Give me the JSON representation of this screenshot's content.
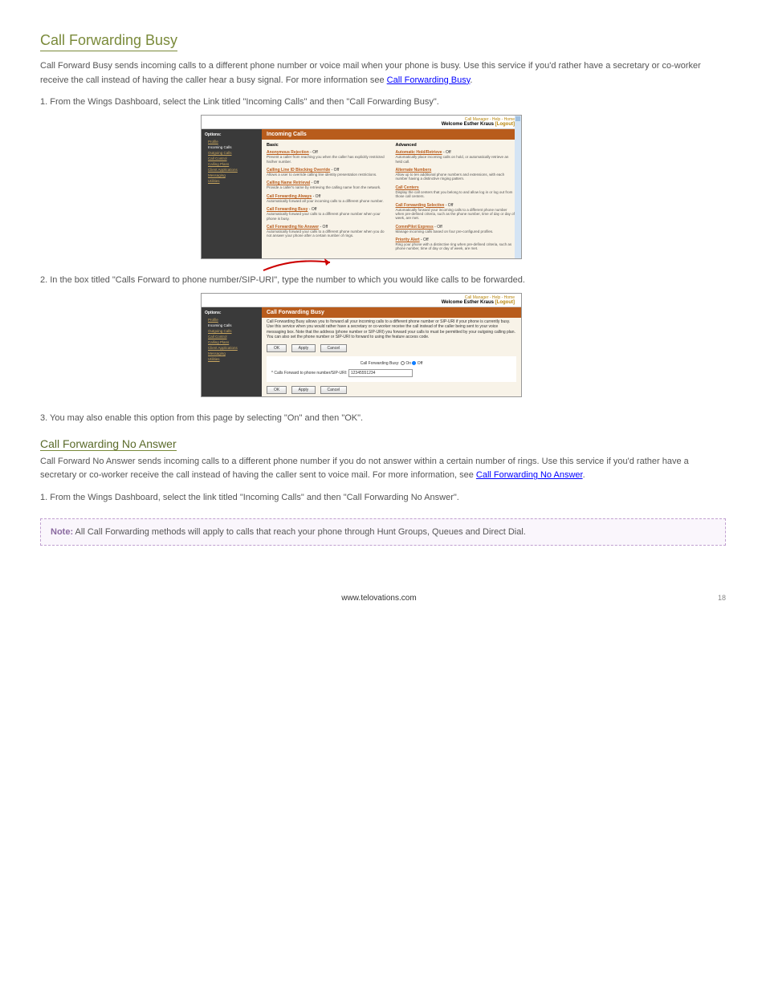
{
  "doc": {
    "heading1": "Call Forwarding Busy",
    "intro": "Call Forward Busy sends incoming calls to a different phone number or voice mail when your phone is busy. Use this service if you'd rather have a secretary or co-worker receive the call instead of having the caller hear a busy signal. For more information see ",
    "introLinkText": "Call Forwarding Busy",
    "introEnd": ".",
    "step1": "1. From the Wings Dashboard, select the Link titled \"Incoming Calls\" and then \"Call Forwarding Busy\".",
    "step2": "2. In the box titled \"Calls Forward to phone number/SIP-URI\", type the number to which you would like calls to be forwarded.",
    "step3": "3. You may also enable this option from this page by selecting \"On\" and then \"OK\".",
    "heading2": "Call Forwarding No Answer",
    "cfna_intro": "Call Forward No Answer sends incoming calls to a different phone number if you do not answer within a certain number of rings. Use this service if you'd rather have a secretary or co-worker receive the call instead of having the caller sent to voice mail. For more information, see ",
    "cfna_link": "Call Forwarding No Answer",
    "cfna_end": ".",
    "cfna_step1": "1. From the Wings Dashboard, select the link titled \"Incoming Calls\" and then \"Call Forwarding No Answer\".",
    "note_hdr": "Note:",
    "note_body": " All Call Forwarding methods will apply to calls that reach your phone through Hunt Groups, Queues and Direct Dial.",
    "footer_url": "www.telovations.com",
    "page_num": "18"
  },
  "ss1": {
    "topLinks": "Call Manager - Help - Home",
    "welcome": "Welcome Esther Kraus",
    "logout": "[Logout]",
    "sidebar": {
      "header": "Options:",
      "items": [
        "Profile",
        "Incoming Calls",
        "Outgoing Calls",
        "Call Control",
        "Calling Plans",
        "Client Applications",
        "Messaging",
        "Utilities"
      ]
    },
    "title": "Incoming Calls",
    "basic_hdr": "Basic",
    "adv_hdr": "Advanced",
    "basic": [
      {
        "t": "Anonymous Rejection",
        "s": "- Off",
        "d": "Prevent a caller from reaching you when the caller has explicitly restricted his/her number."
      },
      {
        "t": "Calling Line ID Blocking Override",
        "s": "- Off",
        "d": "Allows a user to override calling line identity presentation restrictions."
      },
      {
        "t": "Calling Name Retrieval",
        "s": "- Off",
        "d": "Provide a caller's name by retrieving the calling name from the network."
      },
      {
        "t": "Call Forwarding Always",
        "s": "- Off",
        "d": "Automatically forward all your incoming calls to a different phone number."
      },
      {
        "t": "Call Forwarding Busy",
        "s": "- Off",
        "d": "Automatically forward your calls to a different phone number when your phone is busy."
      },
      {
        "t": "Call Forwarding No Answer",
        "s": "- Off",
        "d": "Automatically forward your calls to a different phone number when you do not answer your phone after a certain number of rings."
      }
    ],
    "advanced": [
      {
        "t": "Automatic Hold/Retrieve",
        "s": "- Off",
        "d": "Automatically place incoming calls on hold, or automatically retrieve an held call."
      },
      {
        "t": "Alternate Numbers",
        "s": "",
        "d": "Allow up to ten additional phone numbers and extensions, with each number having a distinctive ringing pattern."
      },
      {
        "t": "Call Centers",
        "s": "",
        "d": "Display the call centers that you belong to and allow log in or log out from those call centers."
      },
      {
        "t": "Call Forwarding Selective",
        "s": "- Off",
        "d": "Automatically forward your incoming calls to a different phone number when pre-defined criteria, such as the phone number, time of day or day of week, are met."
      },
      {
        "t": "CommPilot Express",
        "s": "- Off",
        "d": "Manage incoming calls based on four pre-configured profiles."
      },
      {
        "t": "Priority Alert",
        "s": "- Off",
        "d": "Ring your phone with a distinctive ring when pre-defined criteria, such as phone number, time of day or day of week, are met."
      }
    ]
  },
  "ss2": {
    "topLinks": "Call Manager - Help - Home",
    "welcome": "Welcome Esther Kraus",
    "logout": "[Logout]",
    "sidebar": {
      "header": "Options:",
      "items": [
        "Profile",
        "Incoming Calls",
        "Outgoing Calls",
        "Call Control",
        "Calling Plans",
        "Client Applications",
        "Messaging",
        "Utilities"
      ]
    },
    "title": "Call Forwarding Busy",
    "desc": "Call Forwarding Busy allows you to forward all your incoming calls to a different phone number or SIP-URI if your phone is currently busy. Use this service when you would rather have a secretary or co-worker receive the call instead of the caller being sent to your voice messaging box. Note that the address (phone number or SIP-URI) you forward your calls to must be permitted by your outgoing calling plan. You can also set the phone number or SIP-URI to forward to using the feature access code.",
    "btns": [
      "OK",
      "Apply",
      "Cancel"
    ],
    "radio_label": "Call Forwarding Busy:",
    "radio_on": "On",
    "radio_off": "Off",
    "input_label": "* Calls Forward to phone number/SIP-URI:",
    "input_value": "12345551234"
  }
}
